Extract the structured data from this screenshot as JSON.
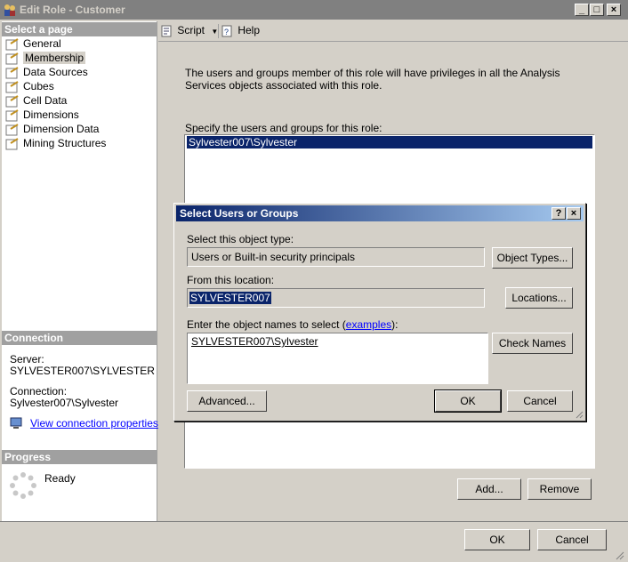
{
  "window": {
    "title": "Edit Role - Customer"
  },
  "left": {
    "select_page_header": "Select a page",
    "pages": [
      "General",
      "Membership",
      "Data Sources",
      "Cubes",
      "Cell Data",
      "Dimensions",
      "Dimension Data",
      "Mining Structures"
    ],
    "connection_header": "Connection",
    "server_label": "Server:",
    "server_value": "SYLVESTER007\\SYLVESTER",
    "connection_label": "Connection:",
    "connection_value": "Sylvester007\\Sylvester",
    "view_props_link": "View connection properties",
    "progress_header": "Progress",
    "progress_status": "Ready"
  },
  "toolbar": {
    "script_label": "Script",
    "help_label": "Help"
  },
  "main": {
    "description": "The users and groups member of this role will have privileges in all the Analysis Services objects associated with this role.",
    "specify_label": "Specify the users and groups for this role:",
    "members": [
      "Sylvester007\\Sylvester"
    ],
    "add_button": "Add...",
    "remove_button": "Remove"
  },
  "dialog": {
    "title": "Select Users or Groups",
    "object_type_label": "Select this object type:",
    "object_type_value": "Users or Built-in security principals",
    "object_types_button": "Object Types...",
    "location_label": "From this location:",
    "location_value": "SYLVESTER007",
    "locations_button": "Locations...",
    "enter_names_label": "Enter the object names to select (",
    "examples_link": "examples",
    "enter_names_suffix": "):",
    "names_value": "SYLVESTER007\\Sylvester",
    "check_names_button": "Check Names",
    "advanced_button": "Advanced...",
    "ok_button": "OK",
    "cancel_button": "Cancel"
  },
  "footer": {
    "ok_button": "OK",
    "cancel_button": "Cancel"
  }
}
